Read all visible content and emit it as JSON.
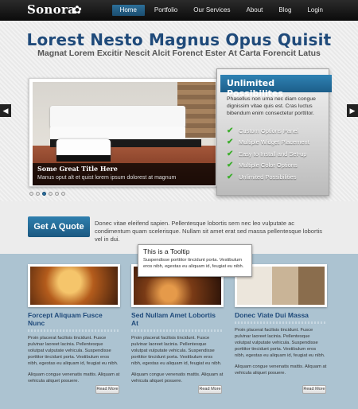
{
  "header": {
    "logo": "Sonora",
    "nav": [
      "Home",
      "Portfolio",
      "Our Services",
      "About",
      "Blog",
      "Login"
    ]
  },
  "hero": {
    "title": "Lorest Nesto Magnus Opus Quisit",
    "subtitle": "Magnat Lorem Excitir Nescit Alcit Forenct Ester At Carta Forencit Latus",
    "caption_title": "Some Great Title Here",
    "caption_text": "Manus oput alt et quist lorem ipsum dolorest at magnum"
  },
  "panel": {
    "heading": "Unlimited Possibilites",
    "text": "Phasellus non urna nec diam congue dignissim vitae quis est. Cras luctus bibendum enim consectetur porttitor.",
    "features": [
      "Custom Options Panel",
      "Multiple Widget Placement",
      "Easy to Install and Set-up",
      "Multiple Color Options",
      "Unlimited Possibilities"
    ]
  },
  "quote": {
    "button": "Get A Quote",
    "text": "Donec vitae eleifend sapien. Pellentesque lobortis sem nec leo vulputate ac condimentum quam scelerisque. Nullam sit amet erat sed massa pellentesque lobortis vel in dui."
  },
  "tooltip": {
    "title": "This is a Tooltip",
    "text": "Suspendisse porttitor tincidunt porta. Vestibulum eros nibh, egestas eu aliquam id, feugiat eu nibh."
  },
  "columns": [
    {
      "title": "Forcept Aliquam Fusce Nunc",
      "text": "Proin placerat facilisis tincidunt. Fusce pulvinar laoreet lacinia. Pellentesque volutpat vulputate vehicula. Suspendisse porttitor tincidunt porta. Vestibulum eros nibh, egestas eu aliquam id, feugiat eu nibh.",
      "text2": "Aliquam congue venenatis mattis. Aliquam at vehicula aliquet posuere.",
      "button": "Read More"
    },
    {
      "title": "Sed Nullam Amet Lobortis At",
      "text": "Proin placerat facilisis tincidunt. Fusce pulvinar laoreet lacinia. Pellentesque volutpat vulputate vehicula. Suspendisse porttitor tincidunt porta. Vestibulum eros nibh, egestas eu aliquam id, feugiat eu nibh.",
      "text2": "Aliquam congue venenatis mattis. Aliquam at vehicula aliquet posuere.",
      "button": "Read More"
    },
    {
      "title": "Donec Viate Dui Massa",
      "text": "Proin placerat facilisis tincidunt. Fusce pulvinar laoreet lacinia. Pellentesque volutpat vulputate vehicula. Suspendisse porttitor tincidunt porta. Vestibulum eros nibh, egestas eu aliquam id, feugiat eu nibh.",
      "text2": "Aliquam congue venenatis mattis. Aliquam at vehicula aliquet posuere.",
      "button": "Read More"
    }
  ],
  "slider": {
    "active_slide": 3,
    "slide_count": 6
  },
  "colors": {
    "accent": "#2b6f9f",
    "title": "#1f4a7a",
    "check": "#3cae2c",
    "bottom_bg": "#acc3d1"
  },
  "icons": {
    "logo": "flower-icon",
    "prev": "arrow-left-icon",
    "next": "arrow-right-icon",
    "check": "check-icon"
  }
}
